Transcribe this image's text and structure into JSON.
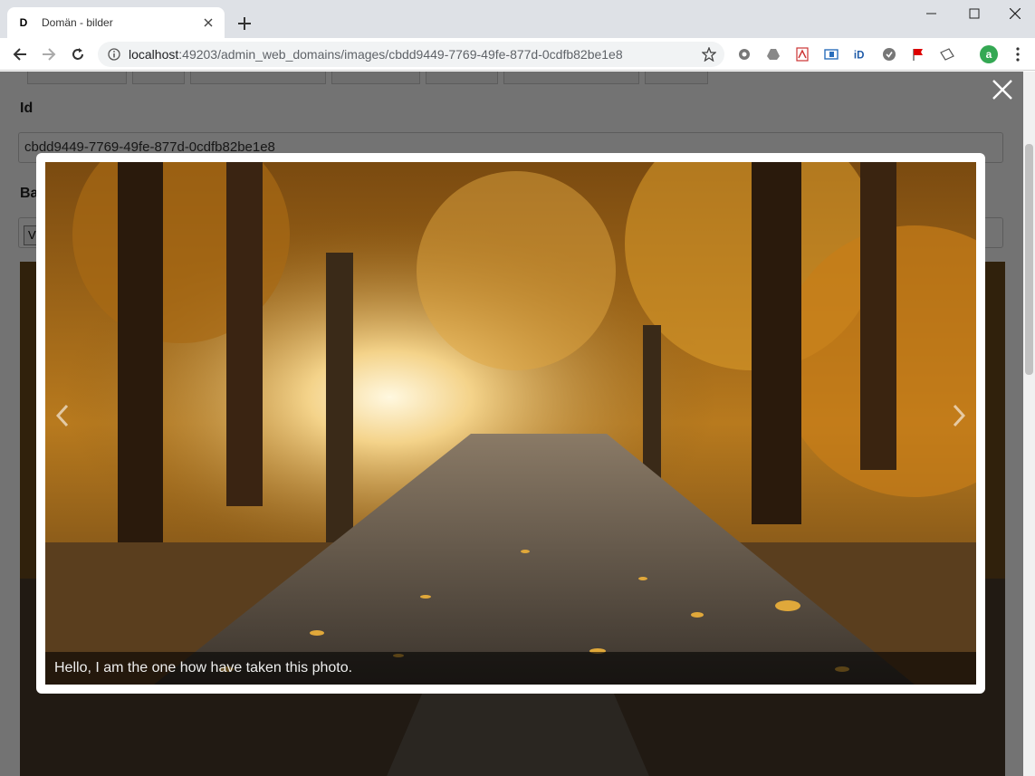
{
  "browser": {
    "tab_title": "Domän - bilder",
    "tab_favicon_letter": "D",
    "url_host": "localhost",
    "url_rest": ":49203/admin_web_domains/images/cbdd9449-7769-49fe-877d-0cdfb82be1e8",
    "profile_initial": "a",
    "extensions": [
      "gear-extension-icon",
      "drive-icon",
      "pdf-icon",
      "outlook-icon",
      "id-icon",
      "shield-icon",
      "flag-icon",
      "ticket-icon"
    ]
  },
  "page": {
    "id_label": "Id",
    "id_value": "cbdd9449-7769-49fe-877d-0cdfb82be1e8",
    "second_label": "Ba",
    "small_button_label": "V"
  },
  "lightbox": {
    "caption": "Hello, I am the one how have taken this photo."
  },
  "colors": {
    "chrome_bg": "#dee1e6",
    "overlay": "rgba(0,0,0,0.55)",
    "profile_green": "#34a853"
  }
}
